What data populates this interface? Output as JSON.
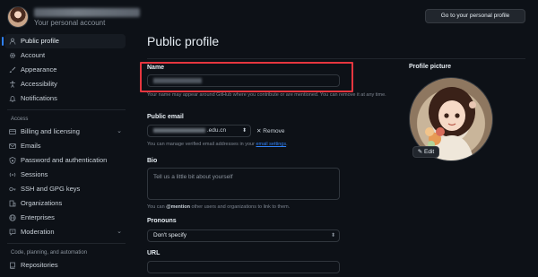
{
  "header": {
    "account_subtitle": "Your personal account",
    "goto_profile_label": "Go to your personal profile"
  },
  "sidebar": {
    "items_top": [
      {
        "label": "Public profile",
        "icon": "person-icon",
        "active": true
      },
      {
        "label": "Account",
        "icon": "gear-icon"
      },
      {
        "label": "Appearance",
        "icon": "paintbrush-icon"
      },
      {
        "label": "Accessibility",
        "icon": "accessibility-icon"
      },
      {
        "label": "Notifications",
        "icon": "bell-icon"
      }
    ],
    "access_label": "Access",
    "items_access": [
      {
        "label": "Billing and licensing",
        "icon": "credit-card-icon",
        "chevron": true
      },
      {
        "label": "Emails",
        "icon": "mail-icon"
      },
      {
        "label": "Password and authentication",
        "icon": "shield-lock-icon"
      },
      {
        "label": "Sessions",
        "icon": "broadcast-icon"
      },
      {
        "label": "SSH and GPG keys",
        "icon": "key-icon"
      },
      {
        "label": "Organizations",
        "icon": "organization-icon"
      },
      {
        "label": "Enterprises",
        "icon": "globe-icon"
      },
      {
        "label": "Moderation",
        "icon": "report-icon",
        "chevron": true
      }
    ],
    "code_label": "Code, planning, and automation",
    "items_code": [
      {
        "label": "Repositories",
        "icon": "repo-icon"
      }
    ]
  },
  "main": {
    "title": "Public profile",
    "name": {
      "label": "Name",
      "help": "Your name may appear around GitHub where you contribute or are mentioned. You can remove it at any time."
    },
    "public_email": {
      "label": "Public email",
      "value_suffix": ".edu.cn",
      "remove_label": "Remove",
      "help_prefix": "You can manage verified email addresses in your ",
      "help_link": "email settings",
      "help_suffix": "."
    },
    "bio": {
      "label": "Bio",
      "placeholder": "Tell us a little bit about yourself",
      "help_prefix": "You can ",
      "help_mention": "@mention",
      "help_suffix": " other users and organizations to link to them."
    },
    "pronouns": {
      "label": "Pronouns",
      "value": "Don't specify"
    },
    "url": {
      "label": "URL"
    }
  },
  "profile_picture": {
    "label": "Profile picture",
    "edit_label": "Edit"
  },
  "colors": {
    "background": "#0d1117",
    "accent": "#2f81f7",
    "highlight": "#e5363f"
  }
}
